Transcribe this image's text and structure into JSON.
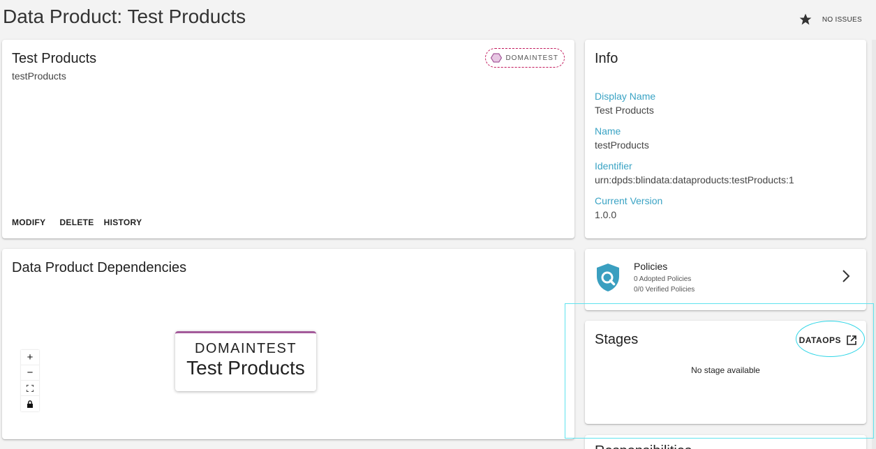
{
  "page": {
    "title": "Data Product: Test Products",
    "issues_label": "NO ISSUES",
    "icons": [
      "star-icon"
    ]
  },
  "main_card": {
    "title": "Test Products",
    "subtitle": "testProducts",
    "domain_chip": "DOMAINTEST",
    "actions": [
      "MODIFY",
      "DELETE",
      "HISTORY"
    ]
  },
  "info_card": {
    "title": "Info",
    "fields": [
      {
        "label": "Display Name",
        "value": "Test Products"
      },
      {
        "label": "Name",
        "value": "testProducts"
      },
      {
        "label": "Identifier",
        "value": "urn:dpds:blindata:dataproducts:testProducts:1"
      },
      {
        "label": "Current Version",
        "value": "1.0.0"
      }
    ]
  },
  "dependencies": {
    "title": "Data Product Dependencies",
    "zoom_controls": [
      "+",
      "−",
      "⛶",
      "🔒"
    ],
    "node": {
      "domain": "DOMAINTEST",
      "name": "Test Products"
    }
  },
  "policies": {
    "title": "Policies",
    "adopted": "0 Adopted Policies",
    "verified": "0/0 Verified Policies"
  },
  "stages": {
    "title": "Stages",
    "dataops_label": "DATAOPS",
    "empty": "No stage available"
  },
  "partial": {
    "title": "Responsibilities"
  },
  "colors": {
    "accent_label": "#3aa3c4",
    "domain": "#a45a9a",
    "policy_icon": "#3a9fc0",
    "highlight": "#2ed5e6"
  }
}
